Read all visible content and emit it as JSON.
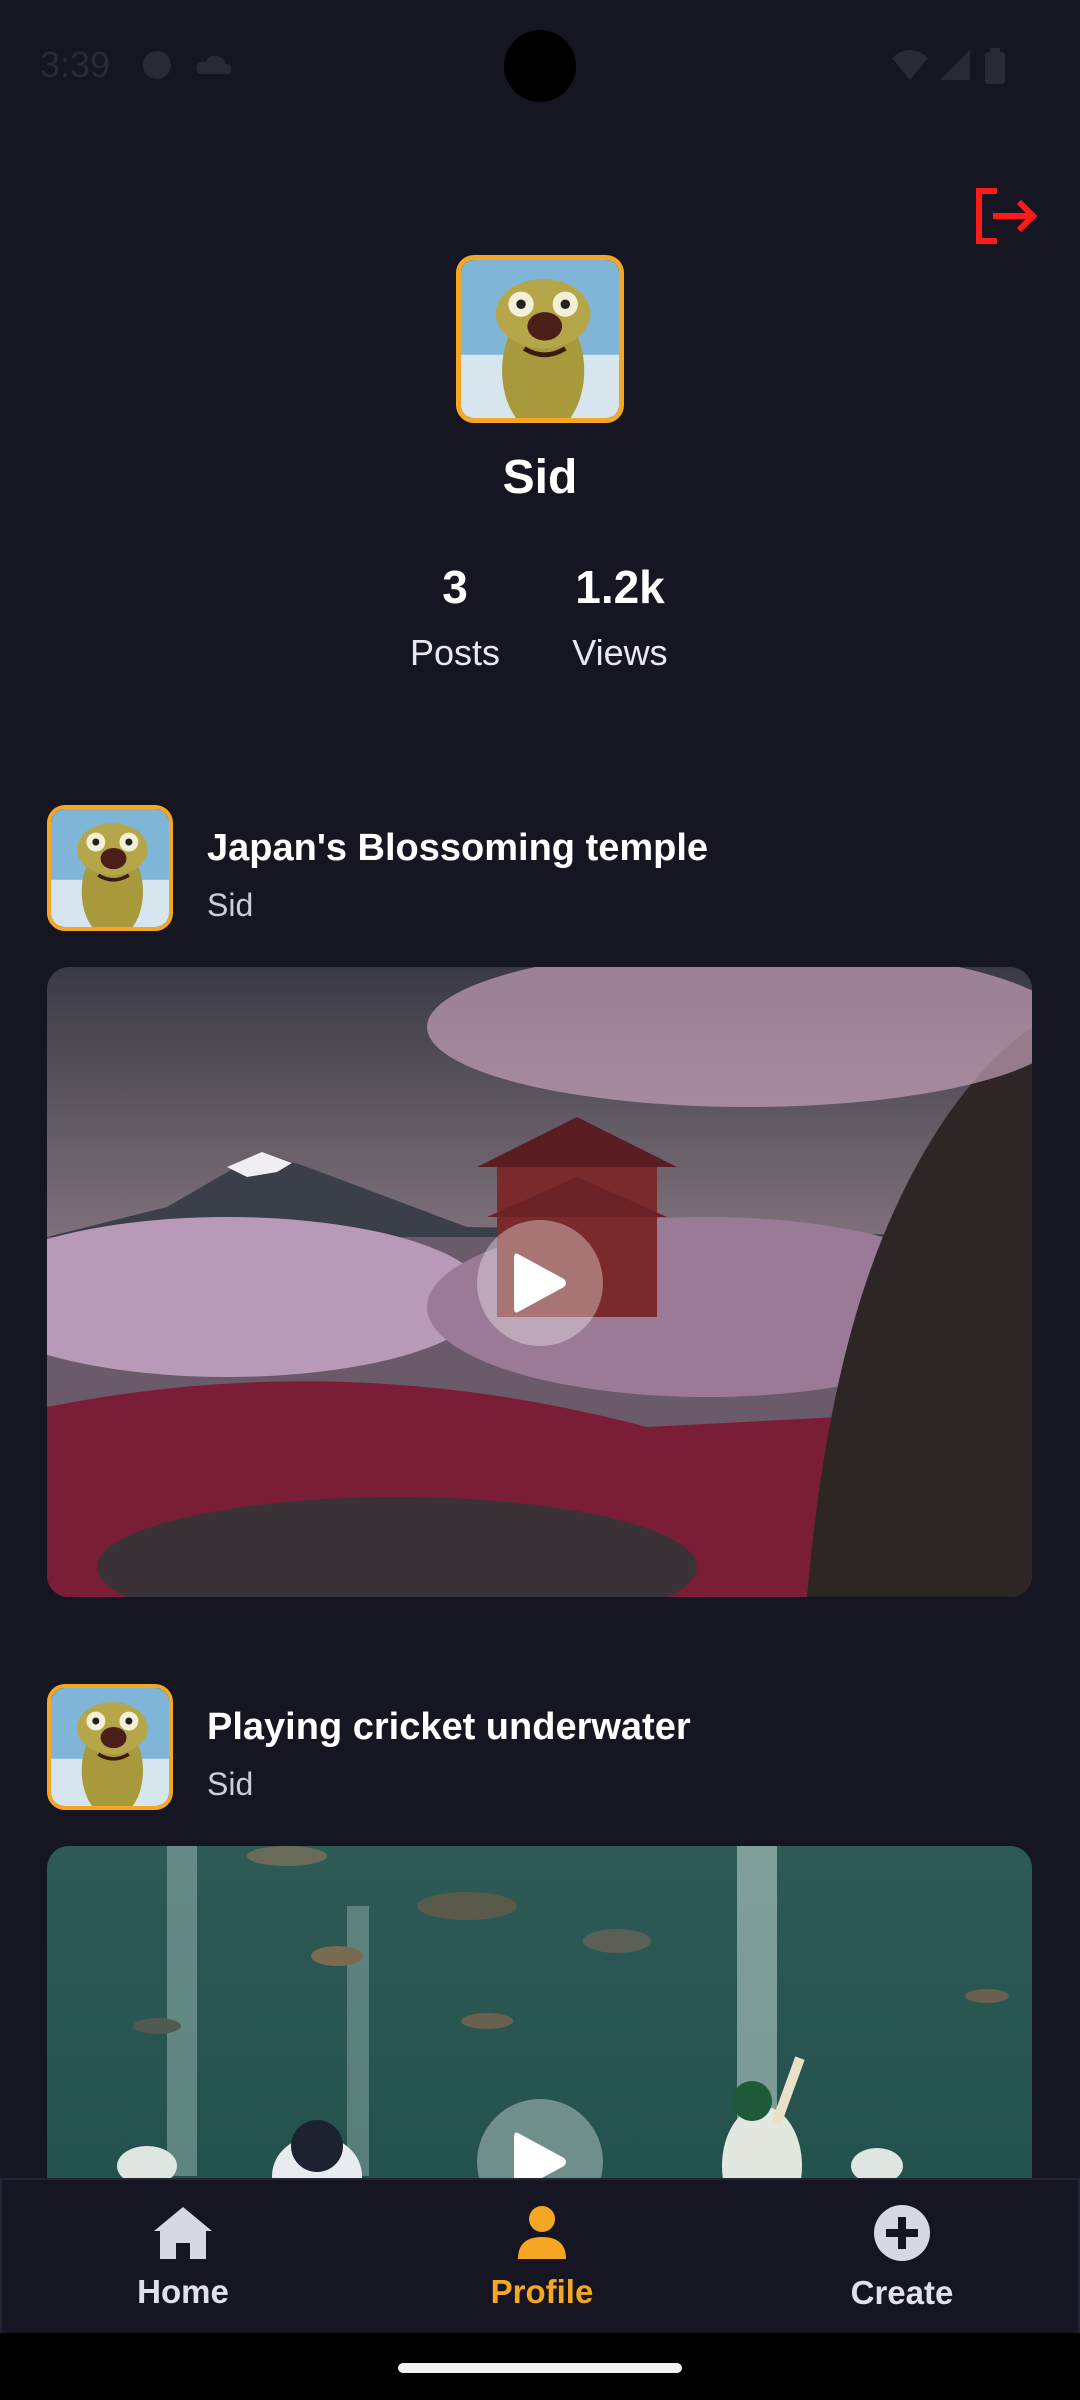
{
  "status_bar": {
    "time": "3:39"
  },
  "profile": {
    "name": "Sid",
    "stats": [
      {
        "value": "3",
        "label": "Posts"
      },
      {
        "value": "1.2k",
        "label": "Views"
      }
    ]
  },
  "posts": [
    {
      "title": "Japan's Blossoming temple",
      "author": "Sid",
      "media_type": "video"
    },
    {
      "title": "Playing cricket underwater",
      "author": "Sid",
      "media_type": "video"
    }
  ],
  "nav": {
    "items": [
      {
        "label": "Home",
        "icon": "home-icon"
      },
      {
        "label": "Profile",
        "icon": "profile-icon",
        "active": true
      },
      {
        "label": "Create",
        "icon": "plus-circle-icon"
      }
    ]
  },
  "colors": {
    "background": "#161622",
    "accent": "#f5a623",
    "logout": "#ff1a1a"
  }
}
